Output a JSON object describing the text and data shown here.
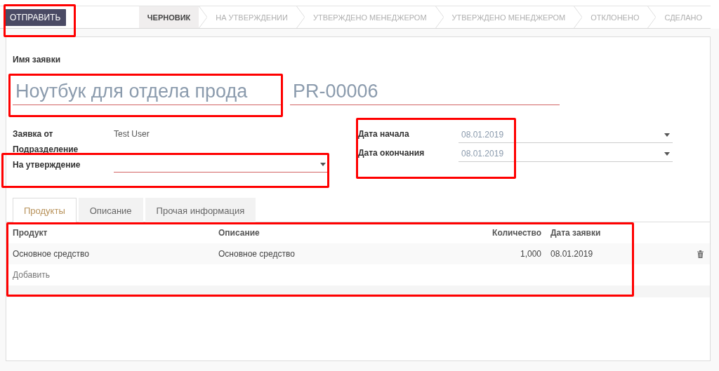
{
  "header": {
    "submit_button": {
      "label": "ОТПРАВИТЬ",
      "highlighted": true
    },
    "stages": [
      {
        "label": "ЧЕРНОВИК",
        "selected": true
      },
      {
        "label": "НА УТВЕРЖДЕНИИ",
        "selected": false
      },
      {
        "label": "УТВЕРЖДЕНО МЕНЕДЖЕРОМ",
        "selected": false
      },
      {
        "label": "УТВЕРЖДЕНО МЕНЕДЖЕРОМ",
        "selected": false
      },
      {
        "label": "ОТКЛОНЕНО",
        "selected": false
      },
      {
        "label": "СДЕЛАНО",
        "selected": false
      }
    ]
  },
  "form": {
    "name_label": "Имя заявки",
    "title": {
      "value": "Ноутбук для отдела прода",
      "required": true,
      "highlighted": true
    },
    "code": {
      "value": "PR-00006",
      "required": true
    },
    "left_fields": [
      {
        "label": "Заявка от",
        "kind": "readonly",
        "value": "Test User",
        "highlighted": false
      },
      {
        "label": "Подразделение",
        "kind": "readonly",
        "highlighted": false
      },
      {
        "label": "На утверждение",
        "kind": "select",
        "required": true,
        "highlighted": true
      }
    ],
    "date_fields": {
      "highlighted": true,
      "fields": [
        {
          "label": "Дата начала",
          "kind": "date",
          "value": "08.01.2019",
          "required": false
        },
        {
          "label": "Дата окончания",
          "kind": "date",
          "value": "08.01.2019",
          "required": false
        }
      ]
    }
  },
  "tabs": [
    {
      "label": "Продукты",
      "selected": true
    },
    {
      "label": "Описание",
      "selected": false
    },
    {
      "label": "Прочая информация",
      "selected": false
    }
  ],
  "table": {
    "highlighted": true,
    "columns": [
      {
        "label": "Продукт",
        "kind": "text"
      },
      {
        "label": "Описание",
        "kind": "text"
      },
      {
        "label": "Количество",
        "kind": "number"
      },
      {
        "label": "Дата заявки",
        "kind": "text"
      }
    ],
    "rows": [
      {
        "cells": [
          "Основное средство",
          "Основное средство",
          "1,000",
          "08.01.2019"
        ]
      }
    ],
    "add_line": "Добавить"
  }
}
